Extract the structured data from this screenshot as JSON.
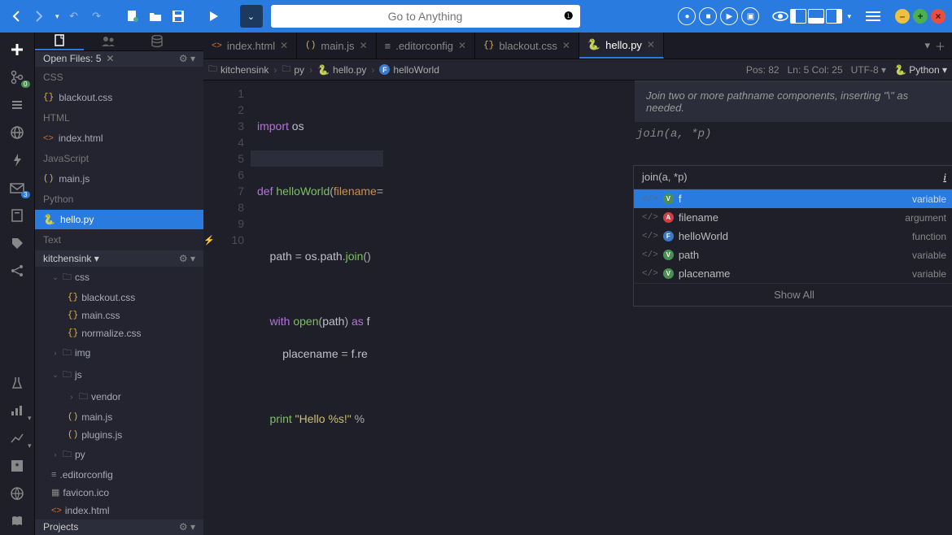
{
  "toolbar": {
    "search_placeholder": "Go to Anything"
  },
  "left_rail": {
    "badge1": "0",
    "badge2": "3"
  },
  "sidebar": {
    "open_files_label": "Open Files: 5",
    "groups": {
      "css": "CSS",
      "html": "HTML",
      "js": "JavaScript",
      "py": "Python",
      "text": "Text"
    },
    "files": {
      "blackout": "blackout.css",
      "index": "index.html",
      "main_js": "main.js",
      "hello_py": "hello.py"
    },
    "tree_header": "kitchensink",
    "tree": {
      "css": "css",
      "blackout": "blackout.css",
      "main_css": "main.css",
      "normalize": "normalize.css",
      "img": "img",
      "js": "js",
      "vendor": "vendor",
      "main_js": "main.js",
      "plugins": "plugins.js",
      "py": "py",
      "editorconfig": ".editorconfig",
      "favicon": "favicon.ico",
      "index_html": "index.html"
    },
    "projects_label": "Projects"
  },
  "tabs": {
    "index": "index.html",
    "main": "main.js",
    "editorconfig": ".editorconfig",
    "blackout": "blackout.css",
    "hello": "hello.py"
  },
  "breadcrumb": {
    "root": "kitchensink",
    "folder": "py",
    "file": "hello.py",
    "symbol": "helloWorld",
    "pos": "Pos: 82",
    "lncol": "Ln: 5 Col: 25",
    "enc": "UTF-8",
    "lang": "Python"
  },
  "code": {
    "l1a": "import",
    "l1b": " os",
    "l3a": "def",
    "l3b": " helloWorld",
    "l3c": "(",
    "l3d": "filename",
    "l3e": "=",
    "l5a": "    path ",
    "l5b": "=",
    "l5c": " os",
    "l5d": ".",
    "l5e": "path",
    "l5f": ".",
    "l5g": "join",
    "l5h": "()",
    "l7a": "    with",
    "l7b": " open",
    "l7c": "(",
    "l7d": "path",
    "l7e": ")",
    "l7f": " as",
    "l7g": " f",
    "l8a": "        placename ",
    "l8b": "=",
    "l8c": " f",
    "l8d": ".",
    "l8e": "re",
    "l10a": "    print",
    "l10b": " \"Hello %s!\"",
    "l10c": " %"
  },
  "gutter": [
    "1",
    "2",
    "3",
    "4",
    "5",
    "6",
    "7",
    "8",
    "9",
    "10"
  ],
  "hint": {
    "text": "Join two or more pathname components, inserting \"\\\" as needed.",
    "sig": "join(a, *p)"
  },
  "completion": {
    "header_sig": "join(a, *p)",
    "info": "i",
    "items": [
      {
        "name": "f",
        "kind": "variable",
        "dot": "V",
        "dotcls": "v-dot"
      },
      {
        "name": "filename",
        "kind": "argument",
        "dot": "A",
        "dotcls": "a-dot"
      },
      {
        "name": "helloWorld",
        "kind": "function",
        "dot": "F",
        "dotcls": "f-dot"
      },
      {
        "name": "path",
        "kind": "variable",
        "dot": "V",
        "dotcls": "v-dot"
      },
      {
        "name": "placename",
        "kind": "variable",
        "dot": "V",
        "dotcls": "v-dot"
      }
    ],
    "footer": "Show All"
  }
}
